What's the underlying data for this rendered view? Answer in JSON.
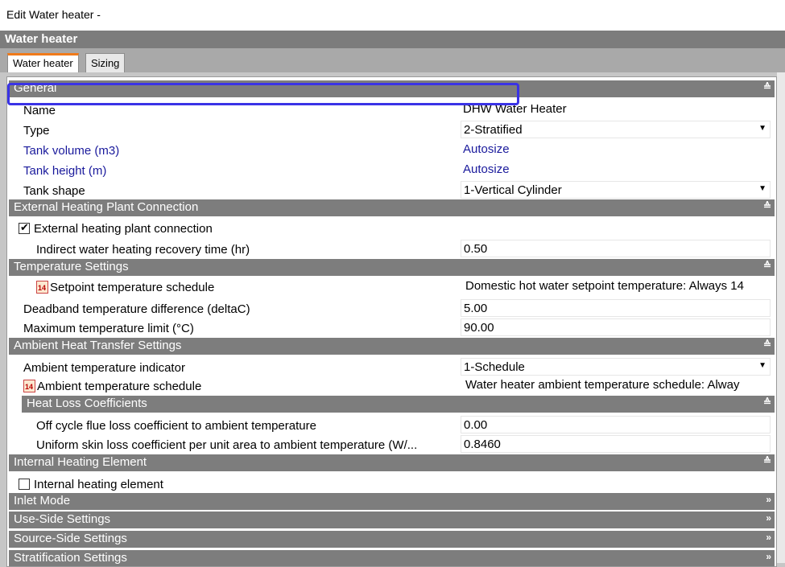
{
  "window": {
    "title": "Edit Water heater -"
  },
  "panel": {
    "title": "Water heater"
  },
  "tabs": [
    {
      "label": "Water heater"
    },
    {
      "label": "Sizing"
    }
  ],
  "sections": {
    "general": "General",
    "external": "External Heating Plant Connection",
    "temperature": "Temperature Settings",
    "ambient": "Ambient Heat Transfer Settings",
    "heat_loss": "Heat Loss Coefficients",
    "internal": "Internal Heating Element",
    "inlet": "Inlet Mode",
    "use_side": "Use-Side Settings",
    "source_side": "Source-Side Settings",
    "stratification": "Stratification Settings"
  },
  "fields": {
    "name": {
      "label": "Name",
      "value": "DHW Water Heater"
    },
    "type": {
      "label": "Type",
      "value": "2-Stratified"
    },
    "tank_volume": {
      "label": "Tank volume (m3)",
      "value": "Autosize"
    },
    "tank_height": {
      "label": "Tank height (m)",
      "value": "Autosize"
    },
    "tank_shape": {
      "label": "Tank shape",
      "value": "1-Vertical Cylinder"
    },
    "external_connection": {
      "label": "External heating plant connection",
      "checked": true
    },
    "recovery_time": {
      "label": "Indirect water heating recovery time (hr)",
      "value": "0.50"
    },
    "setpoint_schedule": {
      "label": "Setpoint temperature schedule",
      "value": "Domestic hot water setpoint temperature: Always 14"
    },
    "deadband": {
      "label": "Deadband temperature difference (deltaC)",
      "value": "5.00"
    },
    "max_temp": {
      "label": "Maximum temperature limit (°C)",
      "value": "90.00"
    },
    "ambient_indicator": {
      "label": "Ambient temperature indicator",
      "value": "1-Schedule"
    },
    "ambient_schedule": {
      "label": "Ambient temperature schedule",
      "value": "Water heater ambient temperature schedule: Alway"
    },
    "off_cycle": {
      "label": "Off cycle flue loss coefficient to ambient temperature",
      "value": "0.00"
    },
    "skin_loss": {
      "label": "Uniform skin loss coefficient per unit area to ambient temperature (W/...",
      "value": "0.8460"
    },
    "internal_element": {
      "label": "Internal heating element",
      "checked": false
    }
  },
  "icons": {
    "collapse": "chevron-double-up-icon",
    "expand": "chevron-double-right-icon",
    "schedule": "calendar-schedule-icon",
    "dropdown": "dropdown-arrow-icon"
  },
  "colors": {
    "section_header": "#7d7d7d",
    "highlight": "#3a33e6",
    "link_text": "#1a1a9c",
    "active_tab": "#f07a1a"
  }
}
